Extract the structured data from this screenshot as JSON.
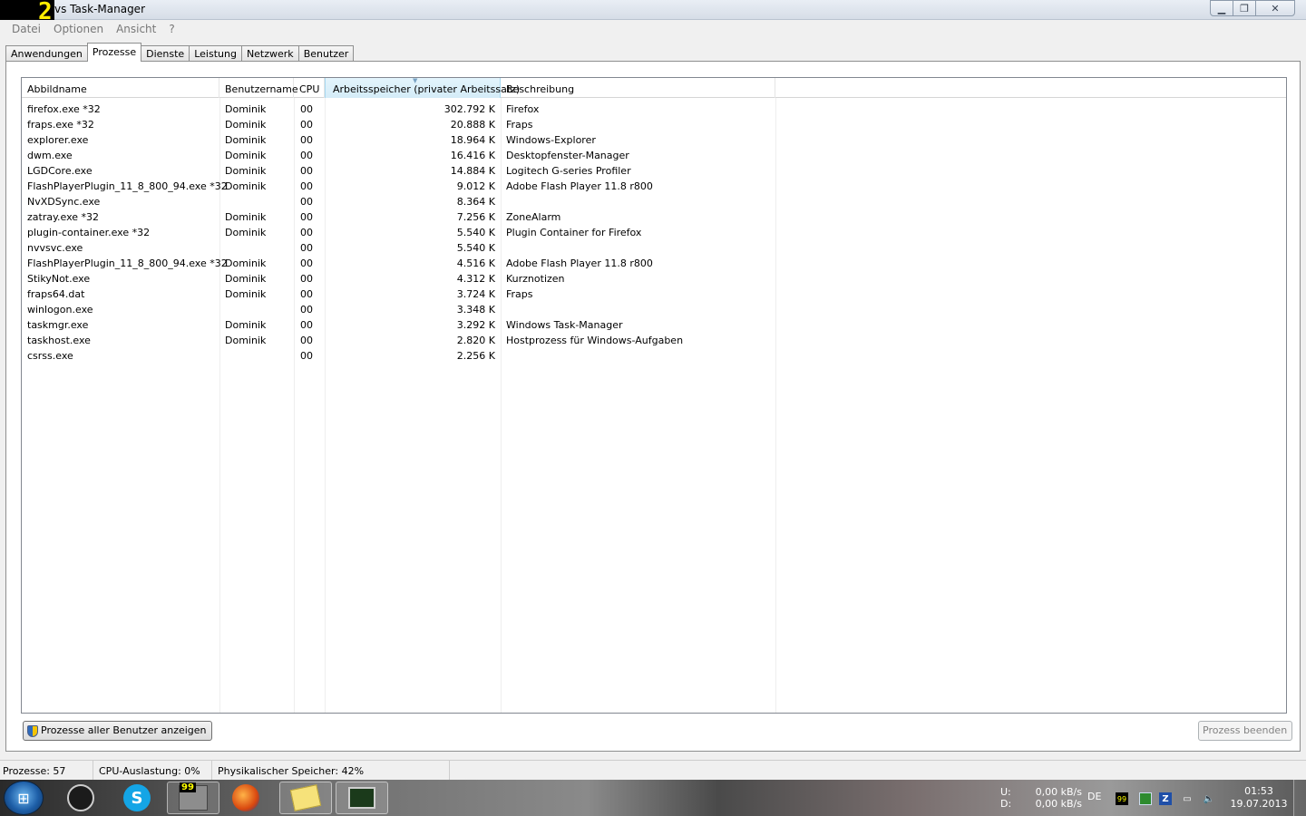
{
  "title_overlay": "2",
  "window": {
    "title": "vs Task-Manager",
    "minimize_label": "▁",
    "maximize_label": "❐",
    "close_label": "✕"
  },
  "menu": [
    "Datei",
    "Optionen",
    "Ansicht",
    "?"
  ],
  "tabs": [
    "Anwendungen",
    "Prozesse",
    "Dienste",
    "Leistung",
    "Netzwerk",
    "Benutzer"
  ],
  "active_tab": "Prozesse",
  "columns": {
    "name": "Abbildname",
    "user": "Benutzername",
    "cpu": "CPU",
    "mem": "Arbeitsspeicher (privater Arbeitssatz)",
    "desc": "Beschreibung"
  },
  "processes": [
    {
      "name": "firefox.exe *32",
      "user": "Dominik",
      "cpu": "00",
      "mem": "302.792 K",
      "desc": "Firefox"
    },
    {
      "name": "fraps.exe *32",
      "user": "Dominik",
      "cpu": "00",
      "mem": "20.888 K",
      "desc": "Fraps"
    },
    {
      "name": "explorer.exe",
      "user": "Dominik",
      "cpu": "00",
      "mem": "18.964 K",
      "desc": "Windows-Explorer"
    },
    {
      "name": "dwm.exe",
      "user": "Dominik",
      "cpu": "00",
      "mem": "16.416 K",
      "desc": "Desktopfenster-Manager"
    },
    {
      "name": "LGDCore.exe",
      "user": "Dominik",
      "cpu": "00",
      "mem": "14.884 K",
      "desc": "Logitech G-series Profiler"
    },
    {
      "name": "FlashPlayerPlugin_11_8_800_94.exe *32",
      "user": "Dominik",
      "cpu": "00",
      "mem": "9.012 K",
      "desc": "Adobe Flash Player 11.8 r800"
    },
    {
      "name": "NvXDSync.exe",
      "user": "",
      "cpu": "00",
      "mem": "8.364 K",
      "desc": ""
    },
    {
      "name": "zatray.exe *32",
      "user": "Dominik",
      "cpu": "00",
      "mem": "7.256 K",
      "desc": "ZoneAlarm"
    },
    {
      "name": "plugin-container.exe *32",
      "user": "Dominik",
      "cpu": "00",
      "mem": "5.540 K",
      "desc": "Plugin Container for Firefox"
    },
    {
      "name": "nvvsvc.exe",
      "user": "",
      "cpu": "00",
      "mem": "5.540 K",
      "desc": ""
    },
    {
      "name": "FlashPlayerPlugin_11_8_800_94.exe *32",
      "user": "Dominik",
      "cpu": "00",
      "mem": "4.516 K",
      "desc": "Adobe Flash Player 11.8 r800"
    },
    {
      "name": "StikyNot.exe",
      "user": "Dominik",
      "cpu": "00",
      "mem": "4.312 K",
      "desc": "Kurznotizen"
    },
    {
      "name": "fraps64.dat",
      "user": "Dominik",
      "cpu": "00",
      "mem": "3.724 K",
      "desc": "Fraps"
    },
    {
      "name": "winlogon.exe",
      "user": "",
      "cpu": "00",
      "mem": "3.348 K",
      "desc": ""
    },
    {
      "name": "taskmgr.exe",
      "user": "Dominik",
      "cpu": "00",
      "mem": "3.292 K",
      "desc": "Windows Task-Manager"
    },
    {
      "name": "taskhost.exe",
      "user": "Dominik",
      "cpu": "00",
      "mem": "2.820 K",
      "desc": "Hostprozess für Windows-Aufgaben"
    },
    {
      "name": "csrss.exe",
      "user": "",
      "cpu": "00",
      "mem": "2.256 K",
      "desc": ""
    }
  ],
  "buttons": {
    "show_all_users": "Prozesse aller Benutzer anzeigen",
    "end_process": "Prozess beenden"
  },
  "status": {
    "processes": "Prozesse: 57",
    "cpu": "CPU-Auslastung: 0%",
    "memory": "Physikalischer Speicher: 42%"
  },
  "taskbar": {
    "start_glyph": "⊞",
    "skype_glyph": "S",
    "fraps_badge": "99",
    "net_up_label": "U:",
    "net_up_value": "0,00 kB/s",
    "net_down_label": "D:",
    "net_down_value": "0,00 kB/s",
    "language": "DE",
    "tray_fraps": "99",
    "tray_zonealarm": "Z",
    "time": "01:53",
    "date": "19.07.2013"
  }
}
